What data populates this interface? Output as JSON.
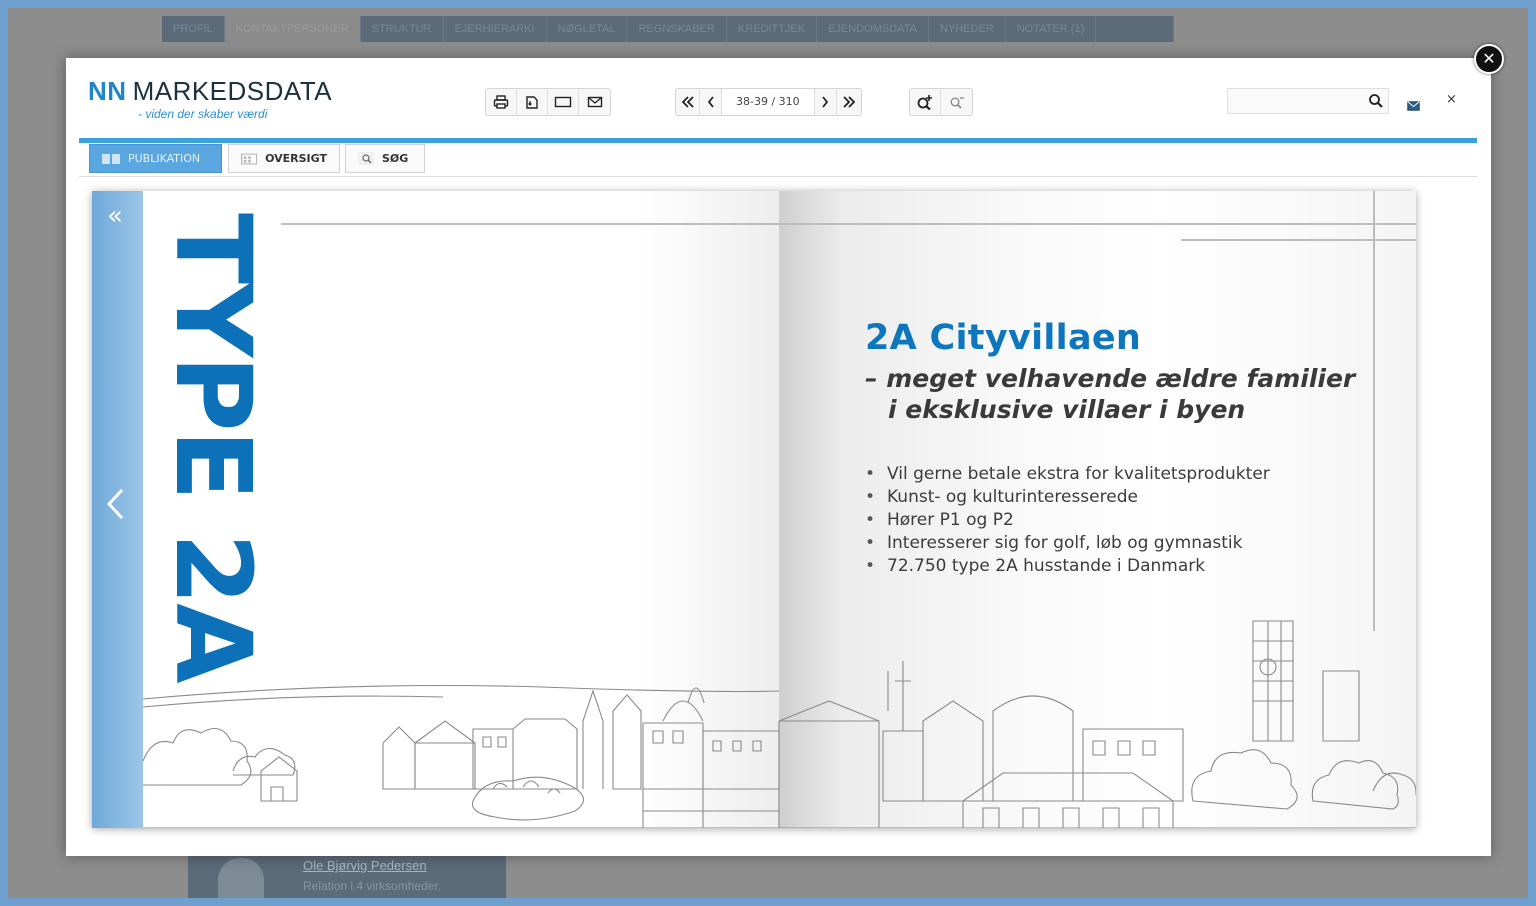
{
  "background": {
    "tabs": [
      "PROFIL",
      "KONTAKTPERSONER",
      "STRUKTUR",
      "EJERHIERARKI",
      "NØGLETAL",
      "REGNSKABER",
      "KREDITTJEK",
      "EJENDOMSDATA",
      "NYHEDER",
      "NOTATER (1)"
    ],
    "contact_name": "Ole Bjørvig Pedersen",
    "contact_relation": "Relation i 4 virksomheder."
  },
  "viewer": {
    "logo_nn": "NN",
    "logo_name": "MARKEDSDATA",
    "logo_tagline": "- viden der skaber værdi",
    "page_indicator": "38-39 / 310",
    "search_placeholder": "",
    "view_tabs": [
      "PUBLIKATION",
      "OVERSIGT",
      "SØG"
    ],
    "accent_color": "#3aa0df",
    "icons": {
      "close": "close-icon",
      "print": "print-icon",
      "save": "save-icon",
      "fullscreen": "fullscreen-icon",
      "email": "mail-icon",
      "first": "first-page-icon",
      "prev": "prev-page-icon",
      "next": "next-page-icon",
      "last": "last-page-icon",
      "zoom_in": "zoom-in-icon",
      "zoom_out": "zoom-out-icon",
      "search": "search-icon"
    }
  },
  "publication": {
    "type_label": "TYPE 2A",
    "title": "2A Cityvillaen",
    "subtitle_line1": "– meget velhavende ældre familier",
    "subtitle_line2": "i eksklusive villaer i byen",
    "bullets": [
      "Vil gerne betale ekstra for kvalitetsprodukter",
      "Kunst- og kulturinteresserede",
      "Hører P1 og P2",
      "Interesserer sig for golf, løb og gymnastik",
      "72.750 type 2A husstande i Danmark"
    ],
    "brand_color": "#0c71b8"
  }
}
